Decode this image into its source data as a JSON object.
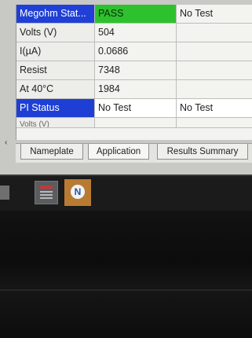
{
  "table": {
    "header": {
      "label": "Megohm Stat...",
      "result": "PASS",
      "extra": "No Test"
    },
    "rows": [
      {
        "label": "Volts (V)",
        "value": "504",
        "extra": ""
      },
      {
        "label": "I(µA)",
        "value": "0.0686",
        "extra": ""
      },
      {
        "label": "Resist",
        "value": "7348",
        "extra": ""
      },
      {
        "label": "At 40°C",
        "value": "1984",
        "extra": ""
      },
      {
        "label": "PI Status",
        "value": "No Test",
        "extra": "No Test"
      },
      {
        "label": "Volts (V)",
        "value": "",
        "extra": ""
      }
    ]
  },
  "tabs": {
    "nameplate": "Nameplate",
    "application": "Application",
    "results_summary": "Results Summary"
  },
  "colors": {
    "header_label_bg": "#1f3fd6",
    "pass_bg": "#2ec12e",
    "selected_row_bg": "#1e3fd4",
    "taskbar_app_icon": "#b97b33"
  },
  "icons": {
    "scroll_left": "chevron-left-icon",
    "taskbar_app1": "document-app-icon",
    "taskbar_app2": "n-logo-app-icon"
  }
}
